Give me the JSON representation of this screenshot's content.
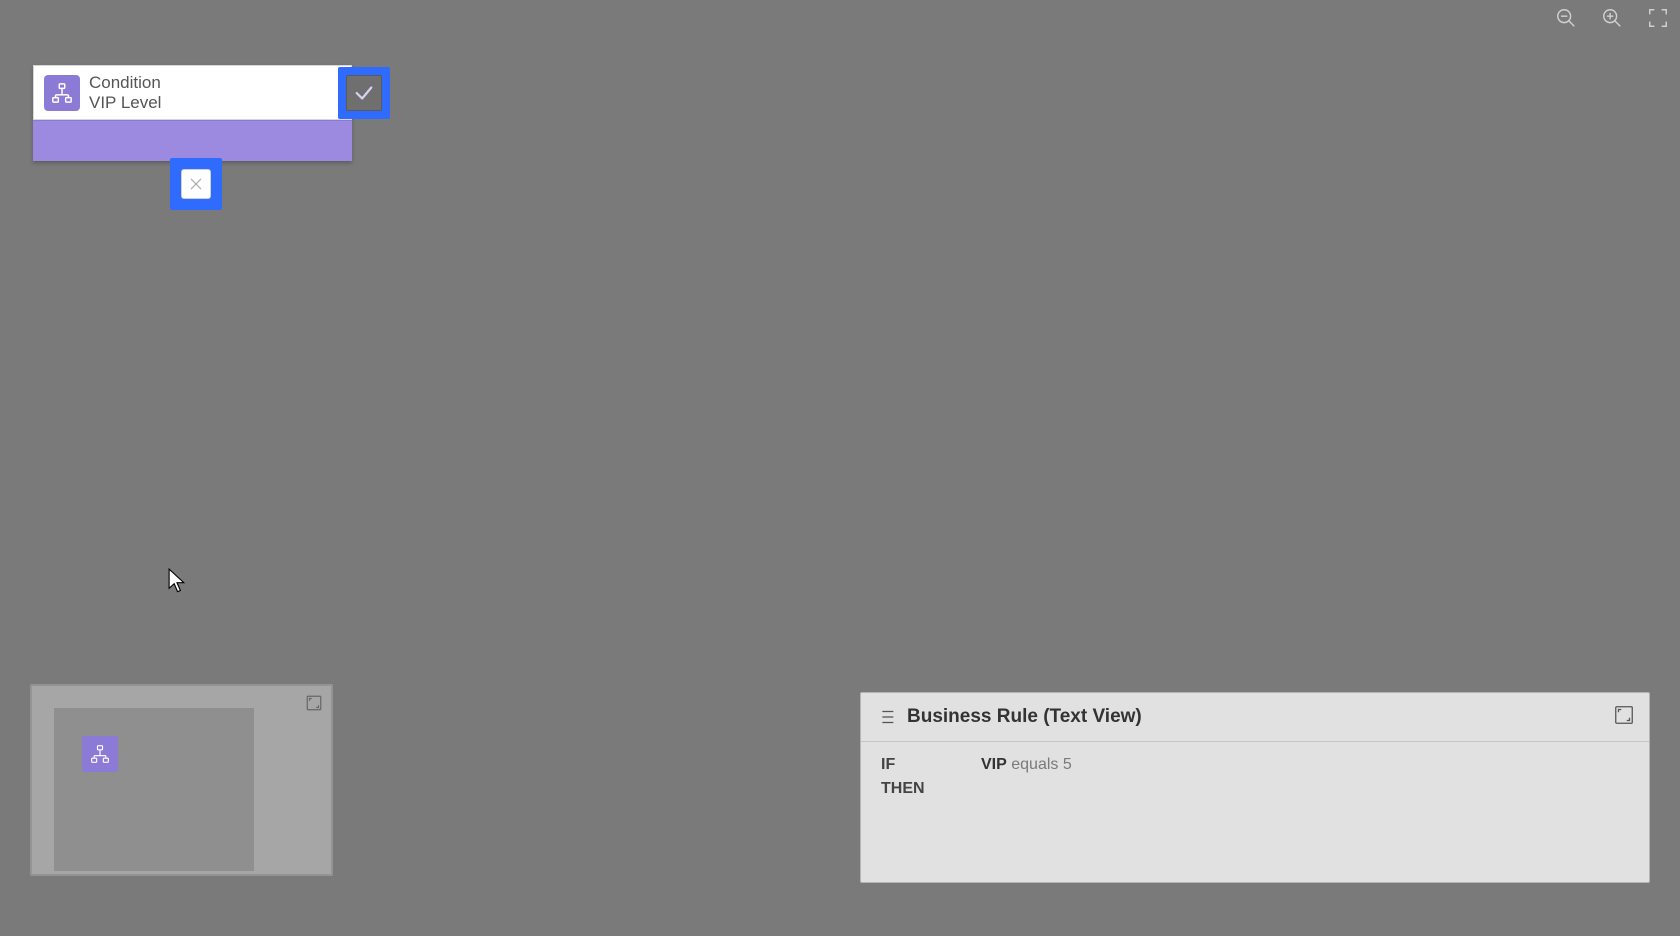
{
  "toolbar": {
    "zoom_out": "zoom-out",
    "zoom_in": "zoom-in",
    "fit": "fit-to-screen"
  },
  "condition_node": {
    "type_label": "Condition",
    "name": "VIP Level"
  },
  "yes_branch": {
    "symbol": "check"
  },
  "no_branch": {
    "symbol": "close"
  },
  "minimap": {
    "expand": "expand"
  },
  "text_view": {
    "title": "Business Rule (Text View)",
    "if_kw": "IF",
    "then_kw": "THEN",
    "expr_field": "VIP",
    "expr_op": "equals",
    "expr_value": "5"
  }
}
